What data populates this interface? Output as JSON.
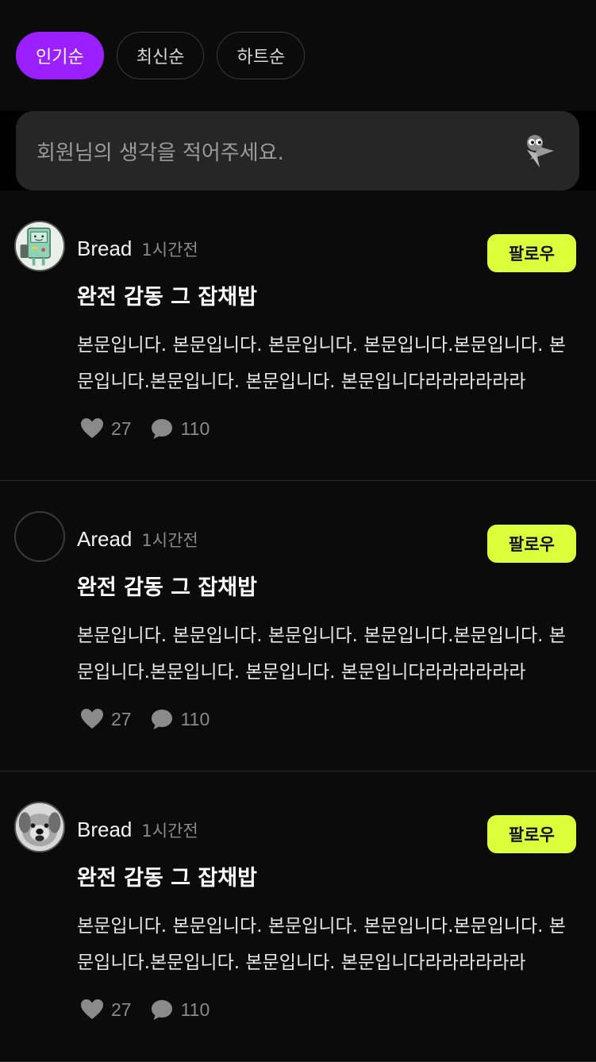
{
  "filters": [
    {
      "label": "인기순",
      "active": true
    },
    {
      "label": "최신순",
      "active": false
    },
    {
      "label": "하트순",
      "active": false
    }
  ],
  "composer": {
    "placeholder": "회원님의 생각을 적어주세요."
  },
  "posts": [
    {
      "author": "Bread",
      "time": "1시간전",
      "follow_label": "팔로우",
      "title": "완전 감동 그 잡채밥",
      "body": "본문입니다. 본문입니다. 본문입니다. 본문입니다.본문입니다. 본문입니다.본문입니다. 본문입니다. 본문입니다라라라라라라",
      "likes": "27",
      "comments": "110",
      "avatar": "robot-avatar"
    },
    {
      "author": "Aread",
      "time": "1시간전",
      "follow_label": "팔로우",
      "title": "완전 감동 그 잡채밥",
      "body": "본문입니다. 본문입니다. 본문입니다. 본문입니다.본문입니다. 본문입니다.본문입니다. 본문입니다. 본문입니다라라라라라라",
      "likes": "27",
      "comments": "110",
      "avatar": "empty-avatar"
    },
    {
      "author": "Bread",
      "time": "1시간전",
      "follow_label": "팔로우",
      "title": "완전 감동 그 잡채밥",
      "body": "본문입니다. 본문입니다. 본문입니다. 본문입니다.본문입니다. 본문입니다.본문입니다. 본문입니다. 본문입니다라라라라라라",
      "likes": "27",
      "comments": "110",
      "avatar": "dog-avatar"
    }
  ],
  "colors": {
    "accent": "#9b1fff",
    "follow_button": "#dcff3c",
    "background": "#0b0b0b"
  },
  "icons": {
    "like": "heart-icon",
    "comment": "speech-bubble-icon",
    "send": "mascot-send-icon"
  }
}
